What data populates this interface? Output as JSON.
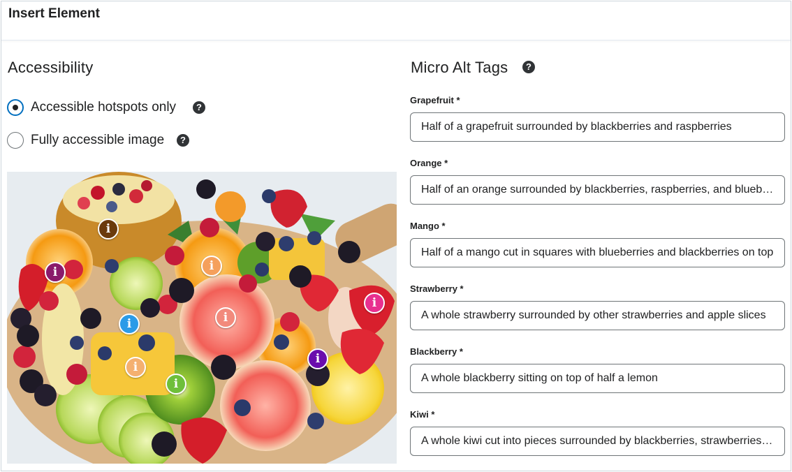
{
  "header": {
    "title": "Insert Element"
  },
  "accessibility": {
    "title": "Accessibility",
    "options": [
      {
        "label": "Accessible hotspots only",
        "checked": true
      },
      {
        "label": "Fully accessible image",
        "checked": false
      }
    ],
    "help_icon": "question-circle-icon"
  },
  "image": {
    "hotspots": [
      {
        "name": "pineapple",
        "color": "#6b3a0c",
        "icon": "info-icon"
      },
      {
        "name": "grapefruit-left",
        "color": "#8a1a6b",
        "icon": "info-icon"
      },
      {
        "name": "orange",
        "color": "#f5a05c",
        "icon": "info-icon"
      },
      {
        "name": "grapefruit",
        "color": "#f28a7c",
        "icon": "info-icon"
      },
      {
        "name": "blue",
        "color": "#2b9be8",
        "icon": "info-icon"
      },
      {
        "name": "mango",
        "color": "#f4b070",
        "icon": "info-icon"
      },
      {
        "name": "kiwi",
        "color": "#6fbf3a",
        "icon": "info-icon"
      },
      {
        "name": "blackberry",
        "color": "#6a0dad",
        "icon": "info-icon"
      },
      {
        "name": "strawberry",
        "color": "#e8308f",
        "icon": "info-icon"
      }
    ],
    "info_glyph": "i"
  },
  "micro_alt_tags": {
    "title": "Micro Alt Tags",
    "fields": [
      {
        "label": "Grapefruit *",
        "value": "Half of a grapefruit surrounded by blackberries and raspberries"
      },
      {
        "label": "Orange *",
        "value": "Half of an orange surrounded by blackberries, raspberries, and blueberries"
      },
      {
        "label": "Mango *",
        "value": "Half of a mango cut in squares with blueberries and blackberries on top"
      },
      {
        "label": "Strawberry *",
        "value": "A whole strawberry surrounded by other strawberries and apple slices"
      },
      {
        "label": "Blackberry *",
        "value": "A whole blackberry sitting on top of half a lemon"
      },
      {
        "label": "Kiwi *",
        "value": "A whole kiwi cut into pieces surrounded by blackberries, strawberries and lemons"
      }
    ]
  },
  "colors": {
    "accent": "#006fbf",
    "text": "#202122",
    "border": "#6e7477"
  }
}
